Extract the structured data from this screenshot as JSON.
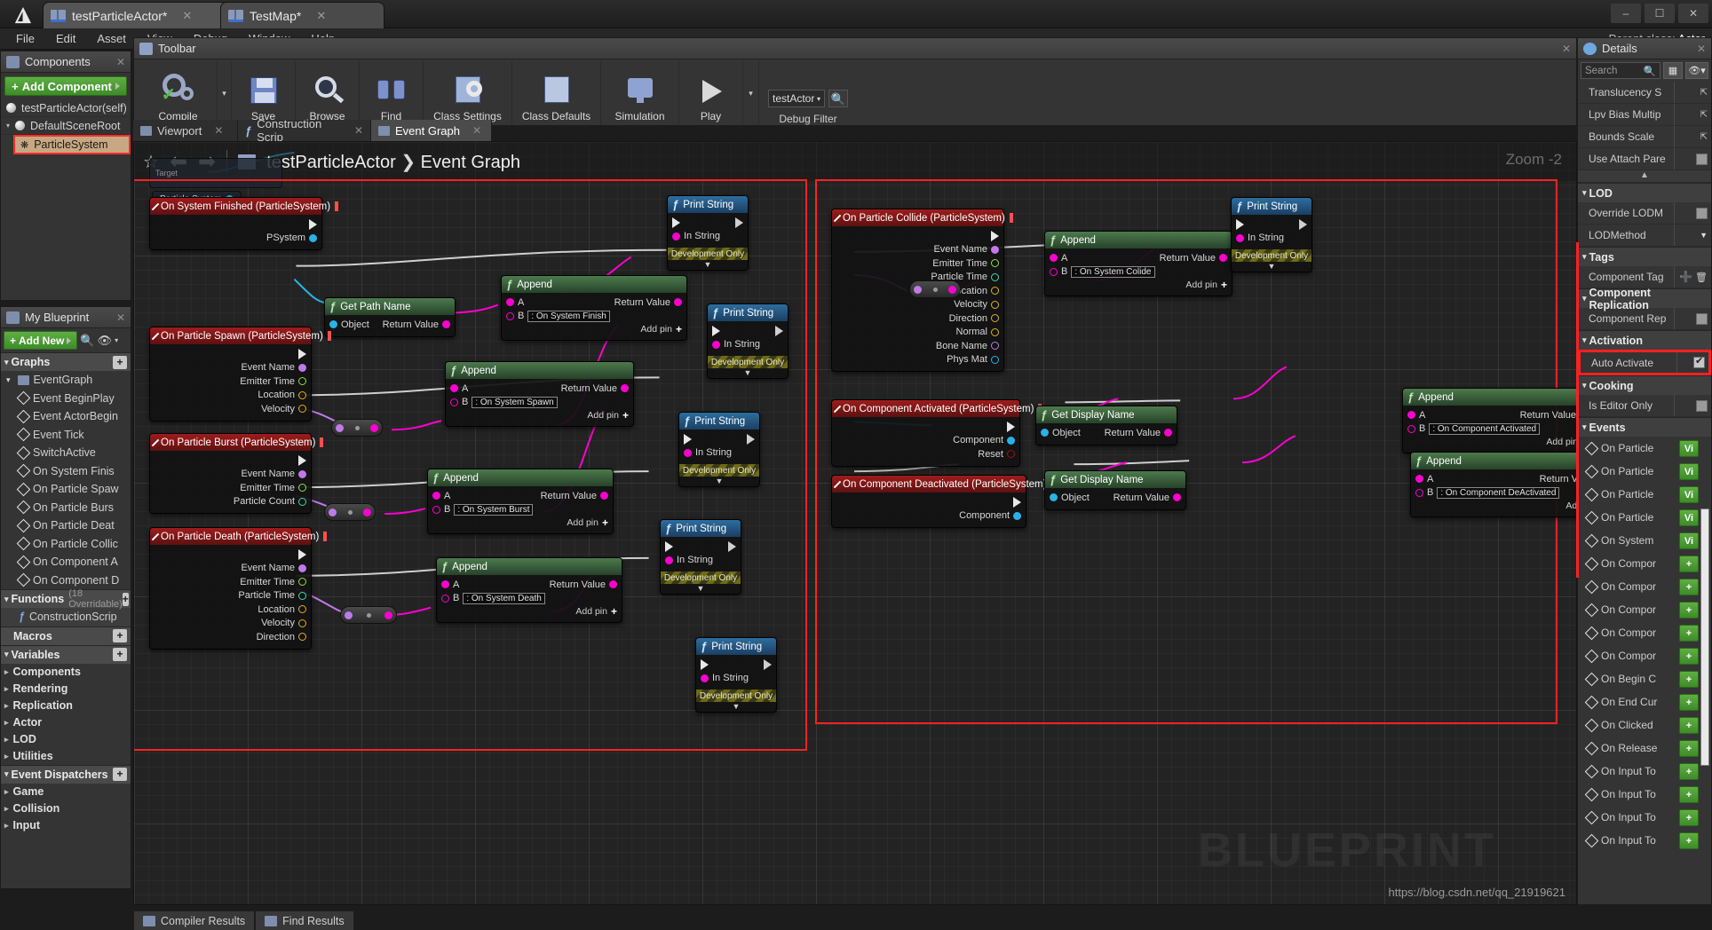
{
  "window": {
    "tabs": [
      {
        "label": "testParticleActor*",
        "active": true
      },
      {
        "label": "TestMap*",
        "active": false
      }
    ],
    "parent_class_label": "Parent class:",
    "parent_class_value": "Actor",
    "close_glyph": "✕"
  },
  "menu": [
    "File",
    "Edit",
    "Asset",
    "View",
    "Debug",
    "Window",
    "Help"
  ],
  "components_panel": {
    "title": "Components",
    "add_button": "Add Component",
    "items": [
      {
        "label": "testParticleActor(self)",
        "indent": 0,
        "selected": false
      },
      {
        "label": "DefaultSceneRoot",
        "indent": 0,
        "selected": false
      },
      {
        "label": "ParticleSystem",
        "indent": 1,
        "selected": true
      }
    ]
  },
  "my_blueprint": {
    "title": "My Blueprint",
    "add_new": "Add New",
    "sections": {
      "graphs": "Graphs",
      "functions": "Functions",
      "functions_sub": "(18 Overridable)",
      "macros": "Macros",
      "variables": "Variables",
      "event_dispatchers": "Event Dispatchers"
    },
    "graph_root": "EventGraph",
    "events": [
      "Event BeginPlay",
      "Event ActorBegin",
      "Event Tick",
      "SwitchActive",
      "On System Finis",
      "On Particle Spaw",
      "On Particle Burs",
      "On Particle Deat",
      "On Particle Collic",
      "On Component A",
      "On Component D"
    ],
    "functions": [
      "ConstructionScrip"
    ],
    "variables": [
      "Components",
      "Rendering",
      "Replication",
      "Actor",
      "LOD",
      "Utilities"
    ],
    "dispatchers": [
      "Game",
      "Collision",
      "Input"
    ]
  },
  "toolbar": {
    "title": "Toolbar",
    "buttons": [
      {
        "label": "Compile",
        "icon": "compile-icon"
      },
      {
        "label": "Save",
        "icon": "save-icon"
      },
      {
        "label": "Browse",
        "icon": "browse-icon"
      },
      {
        "label": "Find",
        "icon": "find-icon"
      },
      {
        "label": "Class Settings",
        "icon": "class-settings-icon"
      },
      {
        "label": "Class Defaults",
        "icon": "class-defaults-icon"
      },
      {
        "label": "Simulation",
        "icon": "simulation-icon"
      },
      {
        "label": "Play",
        "icon": "play-icon"
      }
    ],
    "debug_filter_label": "Debug Filter",
    "debug_filter_value": "testActor"
  },
  "graph_tabs": [
    {
      "label": "Viewport",
      "active": false
    },
    {
      "label": "Construction Scrip",
      "active": false
    },
    {
      "label": "Event Graph",
      "active": true
    }
  ],
  "breadcrumb": {
    "root": "testParticleActor",
    "separator": "❯",
    "leaf": "Event Graph"
  },
  "graph": {
    "zoom_label": "Zoom  -2",
    "watermark": "BLUEPRINT",
    "url": "https://blog.csdn.net/qq_21919621",
    "floating_node_label": "Particle System",
    "target_label": "Target"
  },
  "nodes": {
    "on_system_finished": {
      "title": "On System Finished (ParticleSystem)",
      "pins": [
        "PSystem"
      ]
    },
    "get_path_name": {
      "title": "Get Path Name",
      "in_pin": "Object",
      "out_pin": "Return Value"
    },
    "on_particle_spawn": {
      "title": "On Particle Spawn (ParticleSystem)",
      "pins": [
        "Event Name",
        "Emitter Time",
        "Location",
        "Velocity"
      ]
    },
    "on_particle_burst": {
      "title": "On Particle Burst (ParticleSystem)",
      "pins": [
        "Event Name",
        "Emitter Time",
        "Particle Count"
      ]
    },
    "on_particle_death": {
      "title": "On Particle Death (ParticleSystem)",
      "pins": [
        "Event Name",
        "Emitter Time",
        "Particle Time",
        "Location",
        "Velocity",
        "Direction"
      ]
    },
    "on_particle_collide": {
      "title": "On Particle Collide (ParticleSystem)",
      "pins": [
        "Event Name",
        "Emitter Time",
        "Particle Time",
        "Location",
        "Velocity",
        "Direction",
        "Normal",
        "Bone Name",
        "Phys Mat"
      ]
    },
    "on_component_activated": {
      "title": "On Component Activated (ParticleSystem)",
      "pins": [
        "Component",
        "Reset"
      ]
    },
    "on_component_deactivated": {
      "title": "On Component Deactivated (ParticleSystem)",
      "pins": [
        "Component"
      ]
    },
    "append": {
      "title": "Append",
      "a": "A",
      "b": "B",
      "return": "Return Value",
      "add_pin": "Add pin"
    },
    "append_values": [
      ": On System Finish",
      ": On System Spawn",
      ": On System Burst",
      ": On System Death",
      ": On System Colide",
      ": On Component Activated",
      ": On Component DeActivated"
    ],
    "print_string": {
      "title": "Print String",
      "in_string": "In String",
      "dev_only": "Development Only"
    },
    "get_display_name": {
      "title": "Get Display Name",
      "in_pin": "Object",
      "out_pin": "Return Value"
    }
  },
  "details": {
    "title": "Details",
    "search_placeholder": "Search",
    "rows_top": [
      {
        "label": "Translucency S",
        "kind": "reset"
      },
      {
        "label": "Lpv Bias Multip",
        "kind": "reset"
      },
      {
        "label": "Bounds Scale",
        "kind": "reset"
      },
      {
        "label": "Use Attach Pare",
        "kind": "checkbox",
        "checked": false
      }
    ],
    "sections": [
      {
        "name": "LOD",
        "rows": [
          {
            "label": "Override LODM",
            "kind": "checkbox",
            "checked": false
          },
          {
            "label": "LODMethod",
            "kind": "dropdown"
          }
        ]
      },
      {
        "name": "Tags",
        "rows": [
          {
            "label": "Component Tag",
            "kind": "addrow"
          }
        ]
      },
      {
        "name": "Component Replication",
        "rows": [
          {
            "label": "Component Rep",
            "kind": "checkbox",
            "checked": false
          }
        ]
      },
      {
        "name": "Activation",
        "rows": [
          {
            "label": "Auto Activate",
            "kind": "checkbox",
            "checked": true,
            "highlight": true
          }
        ]
      },
      {
        "name": "Cooking",
        "rows": [
          {
            "label": "Is Editor Only",
            "kind": "checkbox",
            "checked": false
          }
        ]
      }
    ],
    "events_section": "Events",
    "events": [
      {
        "label": "On Particle",
        "button": "Vi"
      },
      {
        "label": "On Particle",
        "button": "Vi"
      },
      {
        "label": "On Particle",
        "button": "Vi"
      },
      {
        "label": "On Particle",
        "button": "Vi"
      },
      {
        "label": "On System",
        "button": "Vi"
      },
      {
        "label": "On Compor",
        "button": "+"
      },
      {
        "label": "On Compor",
        "button": "+"
      },
      {
        "label": "On Compor",
        "button": "+"
      },
      {
        "label": "On Compor",
        "button": "+"
      },
      {
        "label": "On Compor",
        "button": "+"
      },
      {
        "label": "On Begin C",
        "button": "+"
      },
      {
        "label": "On End Cur",
        "button": "+"
      },
      {
        "label": "On Clicked",
        "button": "+"
      },
      {
        "label": "On Release",
        "button": "+"
      },
      {
        "label": "On Input To",
        "button": "+"
      },
      {
        "label": "On Input To",
        "button": "+"
      },
      {
        "label": "On Input To",
        "button": "+"
      },
      {
        "label": "On Input To",
        "button": "+"
      }
    ]
  },
  "bottom_tabs": [
    "Compiler Results",
    "Find Results"
  ],
  "colors": {
    "accent_green": "#4c8a32",
    "selection_red": "#ff2020",
    "exec_white": "#e8e8e8",
    "string_pink": "#ff00d0",
    "object_blue": "#29b2e8",
    "name_purple": "#c07ae8",
    "float_green": "#8ee04a",
    "vector_gold": "#e0b020"
  }
}
